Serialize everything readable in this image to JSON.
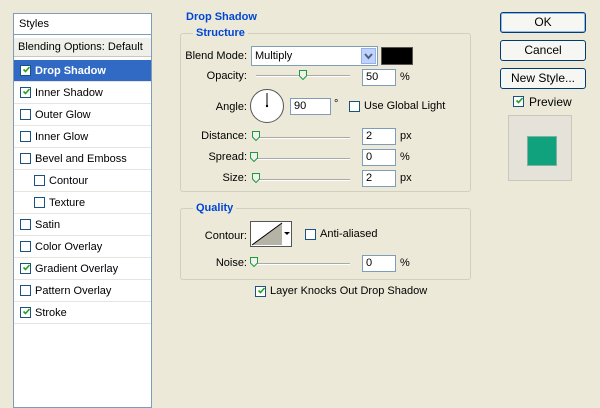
{
  "styles_panel": {
    "header": "Styles",
    "blending_options": "Blending Options: Default",
    "items": [
      {
        "label": "Drop Shadow",
        "checked": true,
        "selected": true,
        "indent": false
      },
      {
        "label": "Inner Shadow",
        "checked": true,
        "selected": false,
        "indent": false
      },
      {
        "label": "Outer Glow",
        "checked": false,
        "selected": false,
        "indent": false
      },
      {
        "label": "Inner Glow",
        "checked": false,
        "selected": false,
        "indent": false
      },
      {
        "label": "Bevel and Emboss",
        "checked": false,
        "selected": false,
        "indent": false
      },
      {
        "label": "Contour",
        "checked": false,
        "selected": false,
        "indent": true
      },
      {
        "label": "Texture",
        "checked": false,
        "selected": false,
        "indent": true
      },
      {
        "label": "Satin",
        "checked": false,
        "selected": false,
        "indent": false
      },
      {
        "label": "Color Overlay",
        "checked": false,
        "selected": false,
        "indent": false
      },
      {
        "label": "Gradient Overlay",
        "checked": true,
        "selected": false,
        "indent": false
      },
      {
        "label": "Pattern Overlay",
        "checked": false,
        "selected": false,
        "indent": false
      },
      {
        "label": "Stroke",
        "checked": true,
        "selected": false,
        "indent": false
      }
    ]
  },
  "drop_shadow": {
    "title": "Drop Shadow",
    "structure": {
      "title": "Structure",
      "blend_mode_label": "Blend Mode:",
      "blend_mode_value": "Multiply",
      "shadow_color": "#000000",
      "opacity_label": "Opacity:",
      "opacity_value": "50",
      "opacity_unit": "%",
      "angle_label": "Angle:",
      "angle_value": "90",
      "angle_unit": "°",
      "use_global_light_label": "Use Global Light",
      "use_global_light_checked": false,
      "distance_label": "Distance:",
      "distance_value": "2",
      "distance_unit": "px",
      "spread_label": "Spread:",
      "spread_value": "0",
      "spread_unit": "%",
      "size_label": "Size:",
      "size_value": "2",
      "size_unit": "px"
    },
    "quality": {
      "title": "Quality",
      "contour_label": "Contour:",
      "anti_aliased_label": "Anti-aliased",
      "anti_aliased_checked": false,
      "noise_label": "Noise:",
      "noise_value": "0",
      "noise_unit": "%"
    },
    "layer_knocks_out_label": "Layer Knocks Out Drop Shadow",
    "layer_knocks_out_checked": true
  },
  "buttons": {
    "ok": "OK",
    "cancel": "Cancel",
    "new_style": "New Style...",
    "preview_label": "Preview",
    "preview_checked": true
  },
  "colors": {
    "selection": "#316ac5",
    "legend": "#0046d5",
    "preview_swatch": "#0fa27c"
  }
}
